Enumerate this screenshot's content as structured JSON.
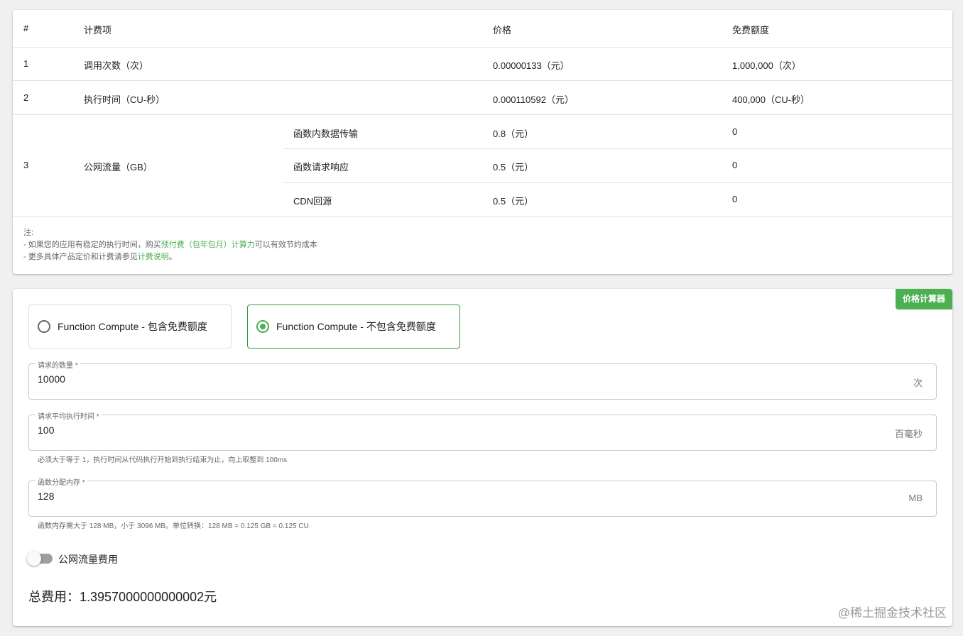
{
  "pricing_table": {
    "headers": [
      "#",
      "计费项",
      "价格",
      "免费额度"
    ],
    "rows": [
      {
        "index": "1",
        "item": "调用次数（次）",
        "price": "0.00000133（元）",
        "free": "1,000,000（次）"
      },
      {
        "index": "2",
        "item": "执行时间（CU-秒）",
        "price": "0.000110592（元）",
        "free": "400,000（CU-秒）"
      }
    ],
    "traffic": {
      "index": "3",
      "item": "公网流量（GB）",
      "subrows": [
        {
          "name": "函数内数据传输",
          "price": "0.8（元）",
          "free": "0"
        },
        {
          "name": "函数请求响应",
          "price": "0.5（元）",
          "free": "0"
        },
        {
          "name": "CDN回源",
          "price": "0.5（元）",
          "free": "0"
        }
      ]
    },
    "notes": {
      "title": "注:",
      "line1_prefix": "- 如果您的应用有稳定的执行时间，购买",
      "line1_link": "预付费（包年包月）计算力",
      "line1_suffix": "可以有效节约成本",
      "line2_prefix": "- 更多具体产品定价和计费请参见",
      "line2_link": "计费说明",
      "line2_suffix": "。"
    }
  },
  "calculator": {
    "badge": "价格计算器",
    "options": [
      {
        "label": "Function Compute - 包含免费额度",
        "selected": false
      },
      {
        "label": "Function Compute - 不包含免费额度",
        "selected": true
      }
    ],
    "fields": [
      {
        "label": "请求的数量 *",
        "value": "10000",
        "unit": "次",
        "helper": ""
      },
      {
        "label": "请求平均执行时间 *",
        "value": "100",
        "unit": "百毫秒",
        "helper": "必须大于等于 1，执行时间从代码执行开始到执行结束为止，向上取整到 100ms"
      },
      {
        "label": "函数分配内存 *",
        "value": "128",
        "unit": "MB",
        "helper": "函数内存需大于 128 MB，小于 3096 MB。单位转换：128 MB = 0.125 GB = 0.125 CU"
      }
    ],
    "toggle": {
      "label": "公网流量费用",
      "on": false
    },
    "total": "总费用：1.3957000000000002元"
  },
  "watermark": "@稀土掘金技术社区",
  "colors": {
    "accent": "#4caf50",
    "selected_border": "#2e9e3a"
  }
}
